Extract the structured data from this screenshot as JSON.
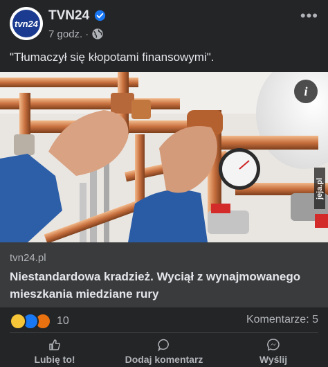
{
  "post": {
    "page_name": "TVN24",
    "avatar_text": "tvn24",
    "time": "7 godz.",
    "separator": "·",
    "text": "\"Tłumaczył się kłopotami finansowymi\".",
    "image_watermark": "jeja.pl"
  },
  "link": {
    "domain": "tvn24.pl",
    "headline": "Niestandardowa kradzież. Wyciął z wynajmowanego mieszkania miedziane rury"
  },
  "stats": {
    "reaction_count": "10",
    "comments": "Komentarze: 5"
  },
  "actions": {
    "like": "Lubię to!",
    "comment": "Dodaj komentarz",
    "share": "Wyślij"
  },
  "colors": {
    "background": "#242526",
    "link_box": "#3a3b3c",
    "verified": "#1877f2"
  },
  "icons": [
    "verified-badge-icon",
    "globe-icon",
    "more-options-icon",
    "info-icon",
    "haha-reaction-icon",
    "like-reaction-icon",
    "angry-reaction-icon",
    "thumbs-up-icon",
    "comment-icon",
    "messenger-icon"
  ]
}
